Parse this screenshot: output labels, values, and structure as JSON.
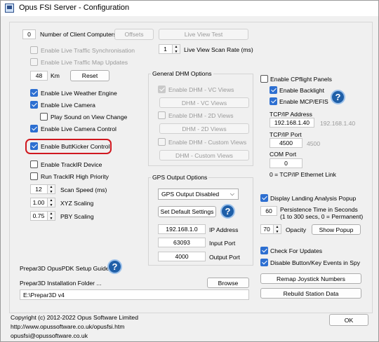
{
  "window": {
    "title": "Opus FSI Server - Configuration"
  },
  "left": {
    "client_computers_value": "0",
    "client_computers_label": "Number of Client Computers",
    "offsets_button": "Offsets",
    "live_view_test_button": "Live View Test",
    "live_traffic_sync": "Enable Live Traffic Synchronisation",
    "live_traffic_updates": "Enable Live Traffic Map Updates",
    "scan_rate_value": "1",
    "scan_rate_label": "Live View Scan Rate (ms)",
    "km_value": "48",
    "km_label": "Km",
    "reset_button": "Reset",
    "live_weather": "Enable Live Weather Engine",
    "live_camera": "Enable Live Camera",
    "play_sound": "Play Sound on View Change",
    "live_camera_control": "Enable Live Camera Control",
    "buttkicker": "Enable ButtKicker Control",
    "trackir_device": "Enable TrackIR Device",
    "trackir_priority": "Run TrackIR High Priority",
    "scan_speed_value": "12",
    "scan_speed_label": "Scan Speed (ms)",
    "xyz_value": "1.00",
    "xyz_label": "XYZ Scaling",
    "pby_value": "0.75",
    "pby_label": "PBY Scaling",
    "pdk_guide": "Prepar3D OpusPDK Setup Guide",
    "install_folder_label": "Prepar3D Installation Folder ...",
    "browse_button": "Browse",
    "install_folder_value": "E:\\Prepar3D v4"
  },
  "dhm": {
    "title": "General DHM Options",
    "vc_views_check": "Enable DHM - VC Views",
    "vc_views_button": "DHM - VC Views",
    "views_2d_check": "Enable DHM - 2D Views",
    "views_2d_button": "DHM - 2D Views",
    "custom_check": "Enable DHM - Custom Views",
    "custom_button": "DHM - Custom Views"
  },
  "gps": {
    "title": "GPS Output Options",
    "select_value": "GPS Output Disabled",
    "default_button": "Set Default Settings",
    "ip_value": "192.168.1.0",
    "ip_label": "IP Address",
    "input_port_value": "63093",
    "input_port_label": "Input Port",
    "output_port_value": "4000",
    "output_port_label": "Output Port"
  },
  "cflight": {
    "enable_panels": "Enable CPflight Panels",
    "backlight": "Enable Backlight",
    "mcp_efis": "Enable MCP/EFIS",
    "tcp_address_label": "TCP/IP Address",
    "tcp_address_value": "192.168.1.40",
    "tcp_address_default": "192.168.1.40",
    "tcp_port_label": "TCP/IP Port",
    "tcp_port_value": "4500",
    "tcp_port_default": "4500",
    "com_port_label": "COM Port",
    "com_port_value": "0",
    "com_port_note": "0 = TCP/IP Ethernet Link"
  },
  "landing": {
    "display_popup": "Display Landing Analysis Popup",
    "persistence_value": "60",
    "persistence_label_1": "Persistence Time in Seconds",
    "persistence_label_2": "(1 to 300 secs, 0 = Permanent)",
    "opacity_value": "70",
    "opacity_label": "Opacity",
    "show_popup_button": "Show Popup"
  },
  "misc": {
    "check_updates": "Check For Updates",
    "disable_spy": "Disable Button/Key Events in Spy",
    "remap_button": "Remap Joystick Numbers",
    "rebuild_button": "Rebuild Station Data"
  },
  "footer": {
    "copyright": "Copyright (c)  2012-2022 Opus Software Limited",
    "url": "http://www.opussoftware.co.uk/opusfsi.htm",
    "email": "opusfsi@opussoftware.co.uk",
    "ok_button": "OK"
  },
  "colors": {
    "accent": "#2d6fd1",
    "help_icon": "#1f5fa8",
    "highlight": "#d0181f"
  }
}
